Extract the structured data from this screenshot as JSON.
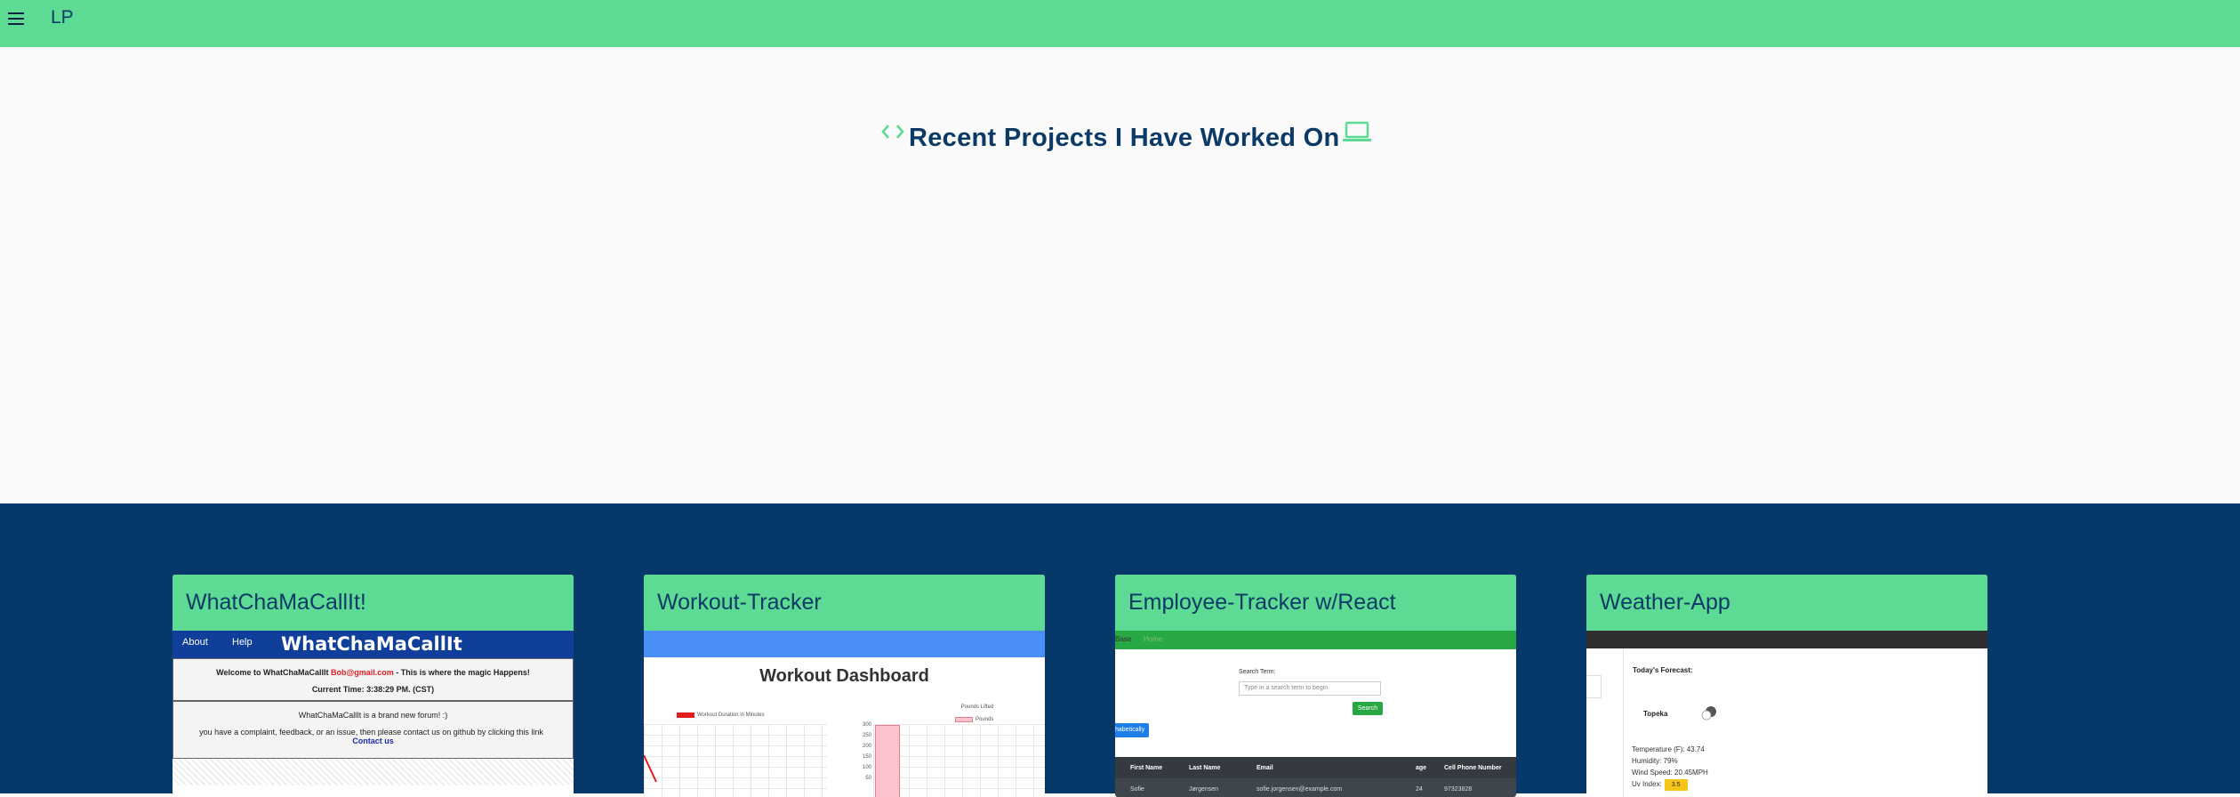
{
  "topbar": {
    "brand": "LP",
    "menu_icon": "hamburger-menu-icon",
    "color": "#5ddb94"
  },
  "hero": {
    "title": "Recent Projects I Have Worked On",
    "left_icon": "code-icon",
    "right_icon": "laptop-icon"
  },
  "projects": [
    {
      "title": "WhatChaMaCallIt!",
      "preview": {
        "nav": [
          "About",
          "Help"
        ],
        "site_title": "WhatChaMaCallIt",
        "welcome_prefix": "Welcome to WhatChaMaCallIt ",
        "email": "Bob@gmail.com",
        "welcome_suffix": " - This is where the magic Happens!",
        "time": "Current Time: 3:38:29 PM. (CST)",
        "intro": "WhatChaMaCallIt is a brand new forum! :)",
        "contact_text": "you have a complaint, feedback, or an issue, then please contact us on github by clicking this link",
        "contact_link": "Contact us"
      }
    },
    {
      "title": "Workout-Tracker",
      "preview": {
        "heading": "Workout Dashboard",
        "legend_left": "Workout Duration in Minutes",
        "legend_right_title": "Pounds Lifted",
        "legend_right": "Pounds",
        "y_ticks": [
          "300",
          "250",
          "200",
          "150",
          "100",
          "50"
        ]
      }
    },
    {
      "title": "Employee-Tracker w/React",
      "preview": {
        "nav": [
          "Base",
          "Home"
        ],
        "search_label": "Search Term:",
        "search_placeholder": "Type in a search term to begin",
        "search_button": "Search",
        "sort_button": "habetically",
        "columns": [
          "First Name",
          "Last Name",
          "Email",
          "age",
          "Cell Phone Number"
        ],
        "row": [
          "Sofie",
          "Jørgensen",
          "sofie.jorgensen@example.com",
          "24",
          "97323828"
        ]
      }
    },
    {
      "title": "Weather-App",
      "preview": {
        "heading": "Today's Forecast:",
        "city": "Topeka",
        "temperature": "Temperature (F): 43.74",
        "humidity": "Humidity: 79%",
        "wind": "Wind Speed: 20.45MPH",
        "uv_label": "Uv Index:",
        "uv_value": "3.5"
      }
    }
  ]
}
